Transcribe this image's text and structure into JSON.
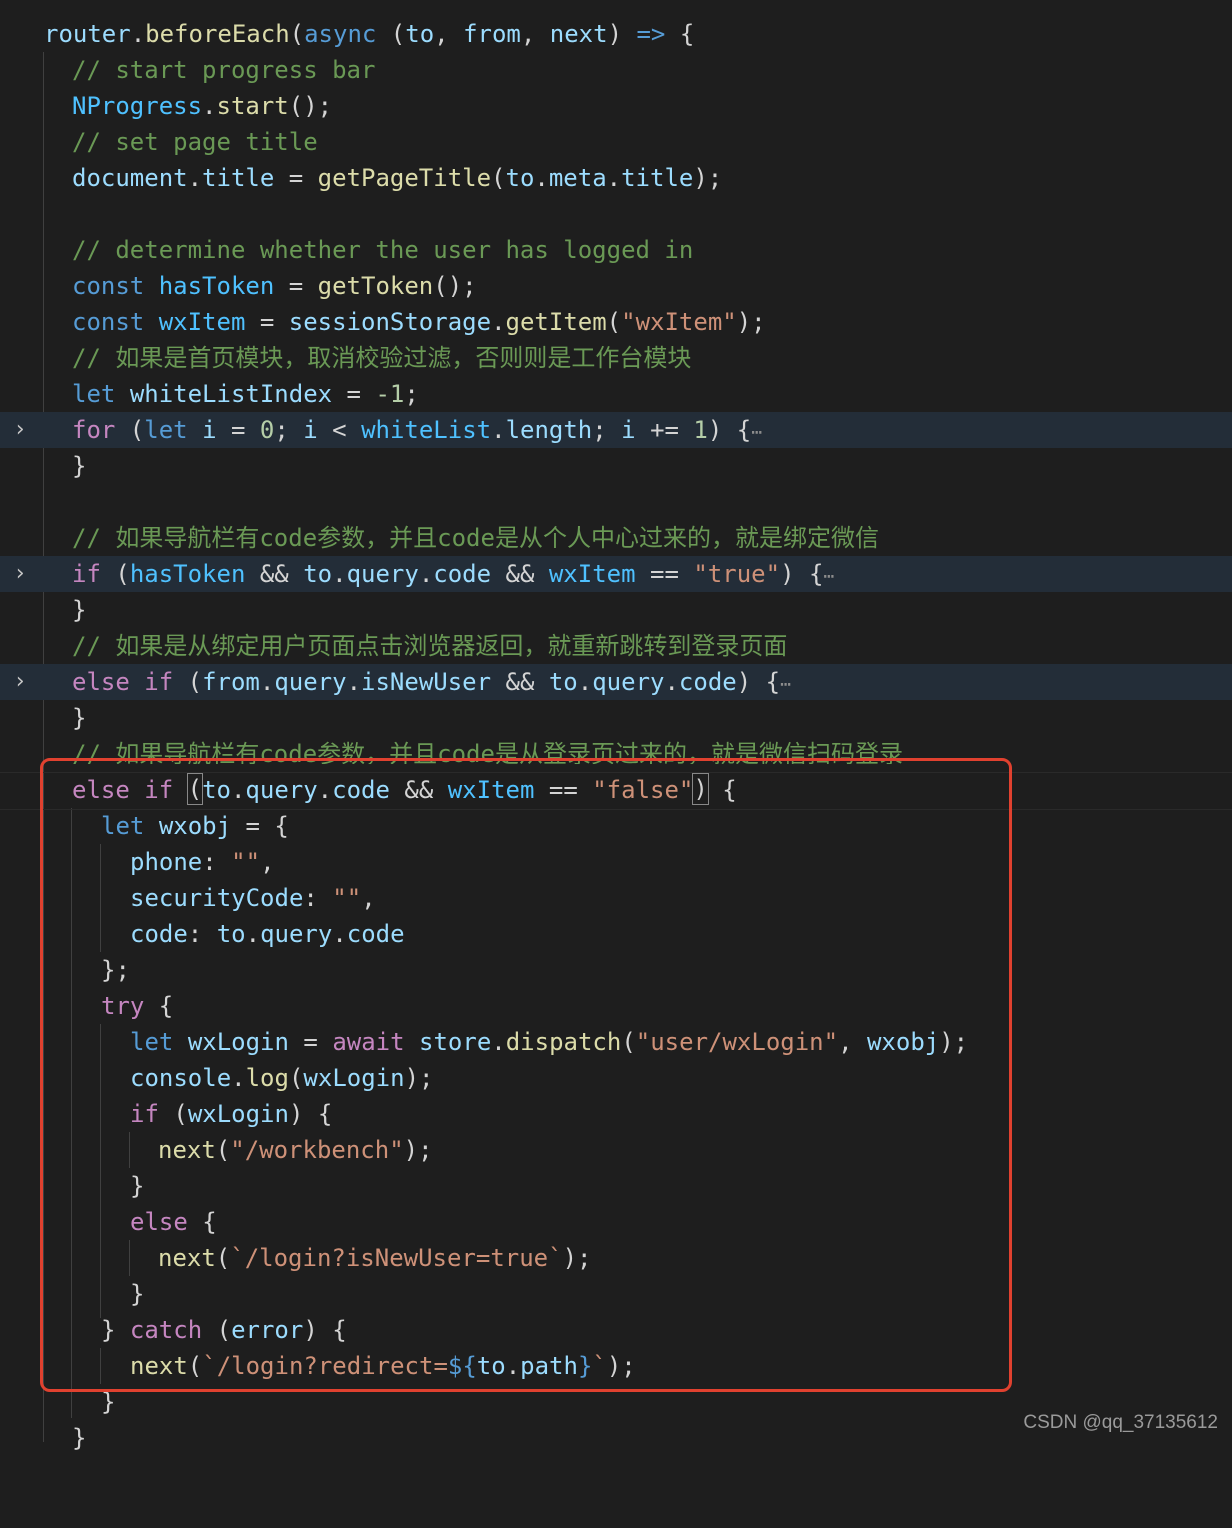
{
  "code": {
    "l1": {
      "a": "router",
      "b": ".",
      "c": "beforeEach",
      "d": "(",
      "e": "async",
      "f": " (",
      "g": "to",
      ",": ", ",
      "h": "from",
      "i": ", ",
      "j": "next",
      "k": ") ",
      "l": "=>",
      "m": " {"
    },
    "l2": "// start progress bar",
    "l3": {
      "a": "NProgress",
      "b": ".",
      "c": "start",
      "d": "();"
    },
    "l4": "// set page title",
    "l5": {
      "a": "document",
      "b": ".",
      "c": "title",
      "d": " = ",
      "e": "getPageTitle",
      "f": "(",
      "g": "to",
      ".1": ".",
      "h": "meta",
      ".2": ".",
      "i": "title",
      "j": ");"
    },
    "l7": "// determine whether the user has logged in",
    "l8": {
      "a": "const",
      "b": " ",
      "c": "hasToken",
      "d": " = ",
      "e": "getToken",
      "f": "();"
    },
    "l9": {
      "a": "const",
      "b": " ",
      "c": "wxItem",
      "d": " = ",
      "e": "sessionStorage",
      "f": ".",
      "g": "getItem",
      "h": "(",
      "i": "\"wxItem\"",
      "j": ");"
    },
    "l10": "// 如果是首页模块，取消校验过滤，否则则是工作台模块",
    "l11": {
      "a": "let",
      "b": " ",
      "c": "whiteListIndex",
      "d": " = ",
      "e": "-1",
      "f": ";"
    },
    "l12": {
      "a": "for",
      "b": " (",
      "c": "let",
      "d": " ",
      "e": "i",
      "f": " = ",
      "g": "0",
      "h": "; ",
      "i": "i",
      "j": " < ",
      "k": "whiteList",
      "l": ".",
      "m": "length",
      "n": "; ",
      "o": "i",
      "p": " += ",
      "q": "1",
      "r": ") {",
      "s": "⋯"
    },
    "l13": "}",
    "l15": "// 如果导航栏有code参数，并且code是从个人中心过来的，就是绑定微信",
    "l16": {
      "a": "if",
      "b": " (",
      "c": "hasToken",
      "d": " && ",
      "e": "to",
      "f": ".",
      "g": "query",
      "h": ".",
      "i": "code",
      "j": " && ",
      "k": "wxItem",
      "l": " == ",
      "m": "\"true\"",
      "n": ") {",
      "s": "⋯"
    },
    "l17": "}",
    "l18": "// 如果是从绑定用户页面点击浏览器返回，就重新跳转到登录页面",
    "l19": {
      "a": "else",
      "b": " ",
      "c": "if",
      "d": " (",
      "e": "from",
      "f": ".",
      "g": "query",
      "h": ".",
      "i": "isNewUser",
      "j": " && ",
      "k": "to",
      "l": ".",
      "m": "query",
      "n": ".",
      "o": "code",
      "p": ") {",
      "s": "⋯"
    },
    "l20": "}",
    "l21": "// 如果导航栏有code参数，并且code是从登录页过来的，就是微信扫码登录",
    "l22": {
      "a": "else",
      "b": " ",
      "c": "if",
      "d": " ",
      "e": "(",
      "f": "to",
      "g": ".",
      "h": "query",
      "i": ".",
      "j": "code",
      "k": " && ",
      "l": "wxItem",
      "m": " == ",
      "n": "\"false\"",
      "o": ")",
      "p": " {"
    },
    "l23": {
      "a": "let",
      "b": " ",
      "c": "wxobj",
      "d": " = {"
    },
    "l24": {
      "a": "phone",
      "b": ": ",
      "c": "\"\"",
      "d": ","
    },
    "l25": {
      "a": "securityCode",
      "b": ": ",
      "c": "\"\"",
      "d": ","
    },
    "l26": {
      "a": "code",
      "b": ": ",
      "c": "to",
      "d": ".",
      "e": "query",
      "f": ".",
      "g": "code"
    },
    "l27": "};",
    "l28": {
      "a": "try",
      "b": " {"
    },
    "l29": {
      "a": "let",
      "b": " ",
      "c": "wxLogin",
      "d": " = ",
      "e": "await",
      "f": " ",
      "g": "store",
      "h": ".",
      "i": "dispatch",
      "j": "(",
      "k": "\"user/wxLogin\"",
      "l": ", ",
      "m": "wxobj",
      "n": ");"
    },
    "l30": {
      "a": "console",
      "b": ".",
      "c": "log",
      "d": "(",
      "e": "wxLogin",
      "f": ");"
    },
    "l31": {
      "a": "if",
      "b": " (",
      "c": "wxLogin",
      "d": ") {"
    },
    "l32": {
      "a": "next",
      "b": "(",
      "c": "\"/workbench\"",
      "d": ");"
    },
    "l33": "}",
    "l34": {
      "a": "else",
      "b": " {"
    },
    "l35": {
      "a": "next",
      "b": "(",
      "c": "`/login?isNewUser=true`",
      "d": ");"
    },
    "l36": "}",
    "l37": {
      "a": "}",
      "b": " ",
      "c": "catch",
      "d": " (",
      "e": "error",
      "f": ") {"
    },
    "l38": {
      "a": "next",
      "b": "(",
      "c": "`/login?redirect=",
      "d": "${",
      "e": "to",
      "f": ".",
      "g": "path",
      "h": "}",
      "i": "`",
      "j": ");"
    },
    "l39": "}",
    "l40": "}"
  },
  "fold_icon": "chevron-right-icon",
  "colors": {
    "highlight_box": "#e0412f",
    "folded_line_bg": "#232d38"
  },
  "watermark": "CSDN @qq_37135612"
}
